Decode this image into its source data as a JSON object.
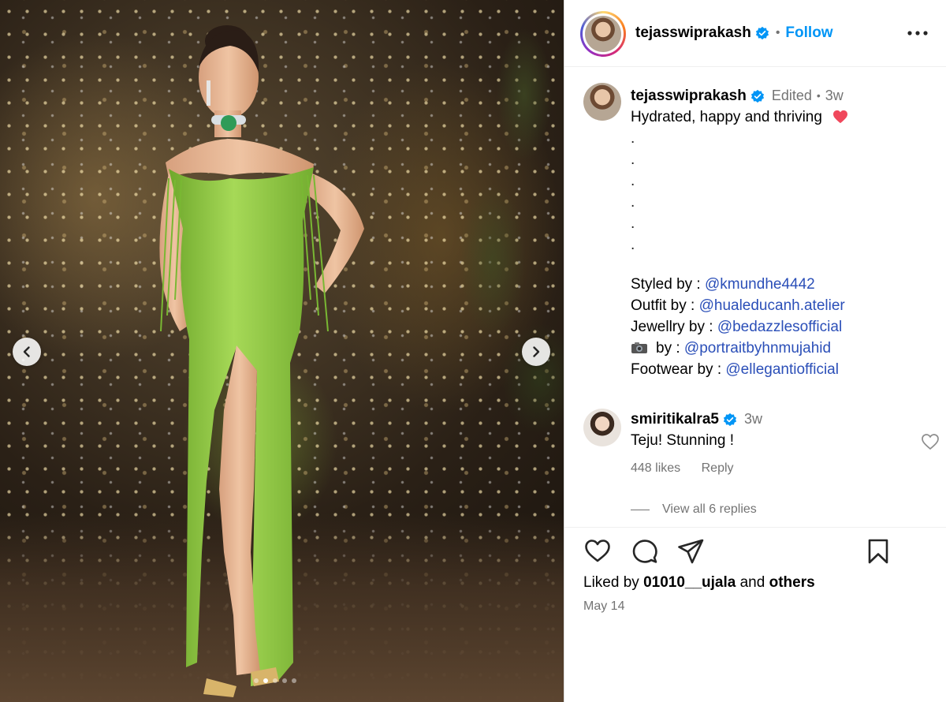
{
  "post": {
    "carousel": {
      "current_index": 2,
      "total": 5
    }
  },
  "header": {
    "username": "tejasswiprakash",
    "separator": "•",
    "follow_label": "Follow"
  },
  "caption": {
    "username": "tejasswiprakash",
    "edited_label": "Edited",
    "separator": "•",
    "time": "3w",
    "text": "Hydrated, happy and thriving",
    "dots": [
      ".",
      ".",
      ".",
      ".",
      ".",
      "."
    ],
    "credits": [
      {
        "label": "Styled by :",
        "mention": "@kmundhe4442"
      },
      {
        "label": "Outfit by :",
        "mention": "@hualeducanh.atelier"
      },
      {
        "label": "Jewellry by :",
        "mention": "@bedazzlesofficial"
      },
      {
        "label": "by :",
        "mention": "@portraitbyhnmujahid",
        "icon": "camera-emoji"
      },
      {
        "label": "Footwear by :",
        "mention": "@ellegantiofficial"
      }
    ]
  },
  "comment": {
    "username": "smiritikalra5",
    "time": "3w",
    "text": "Teju! Stunning !",
    "likes": "448 likes",
    "reply_label": "Reply",
    "view_replies": "View all 6 replies"
  },
  "likes": {
    "prefix": "Liked by",
    "user": "01010__ujala",
    "conjunction": "and",
    "others": "others"
  },
  "date": "May 14",
  "icons": [
    "like-icon",
    "comment-icon",
    "share-icon",
    "save-icon",
    "more-options-icon",
    "verified-badge-icon",
    "chevron-left-icon",
    "chevron-right-icon",
    "heart-emoji",
    "camera-emoji"
  ],
  "colors": {
    "link": "#0095f6",
    "mention": "#2b4fb8",
    "verified": "#0095f6",
    "muted": "#737373",
    "dress": "#8dc63f"
  }
}
